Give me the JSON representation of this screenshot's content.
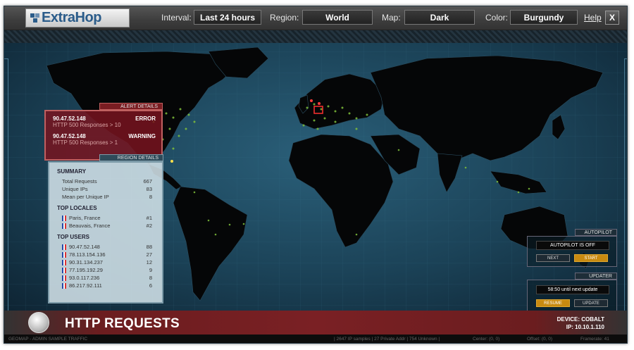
{
  "topbar": {
    "logo_text": "ExtraHop",
    "interval_label": "Interval:",
    "interval_value": "Last 24 hours",
    "region_label": "Region:",
    "region_value": "World",
    "map_label": "Map:",
    "map_value": "Dark",
    "color_label": "Color:",
    "color_value": "Burgundy",
    "help": "Help",
    "close": "X"
  },
  "alert": {
    "header": "ALERT DETAILS",
    "items": [
      {
        "ip": "90.47.52.148",
        "severity": "ERROR",
        "desc": "HTTP 500 Responses > 10"
      },
      {
        "ip": "90.47.52.148",
        "severity": "WARNING",
        "desc": "HTTP 500 Responses > 1"
      }
    ]
  },
  "region": {
    "header": "REGION DETAILS",
    "summary_title": "SUMMARY",
    "summary": [
      {
        "label": "Total Requests",
        "value": "667"
      },
      {
        "label": "Unique IPs",
        "value": "83"
      },
      {
        "label": "Mean per Unique IP",
        "value": "8"
      }
    ],
    "locales_title": "TOP LOCALES",
    "locales": [
      {
        "label": "Paris, France",
        "value": "#1"
      },
      {
        "label": "Beauvais, France",
        "value": "#2"
      }
    ],
    "users_title": "TOP USERS",
    "users": [
      {
        "label": "90.47.52.148",
        "value": "88"
      },
      {
        "label": "78.113.154.136",
        "value": "27"
      },
      {
        "label": "90.31.134.237",
        "value": "12"
      },
      {
        "label": "77.195.192.29",
        "value": "9"
      },
      {
        "label": "93.0.117.236",
        "value": "8"
      },
      {
        "label": "86.217.92.111",
        "value": "6"
      }
    ]
  },
  "autopilot": {
    "header": "AUTOPILOT",
    "status": "AUTOPILOT IS OFF",
    "next": "NEXT",
    "start": "START"
  },
  "updater": {
    "header": "UPDATER",
    "status": "58:50 until next update",
    "resume": "RESUME",
    "update": "UPDATE"
  },
  "footer": {
    "title": "HTTP REQUESTS",
    "device": "DEVICE: COBALT",
    "ip": "IP: 10.10.1.110"
  },
  "statusbar": {
    "left": "GEOMAP - ADMIN SAMPLE TRAFFIC",
    "mid": "| 2647 IP samples | 27 Private Addr | 754 Unknown |",
    "center": "Center: (0, 0)",
    "offset": "Offset: (0, 0)",
    "framerate": "Framerate: 41"
  },
  "colors": {
    "accent": "#7a2024",
    "gold": "#c88a10",
    "ocean": "#1b4257"
  },
  "icons": {
    "logo": "extrahop-logo-icon",
    "globe": "globe-icon",
    "flag": "france-flag-icon"
  }
}
